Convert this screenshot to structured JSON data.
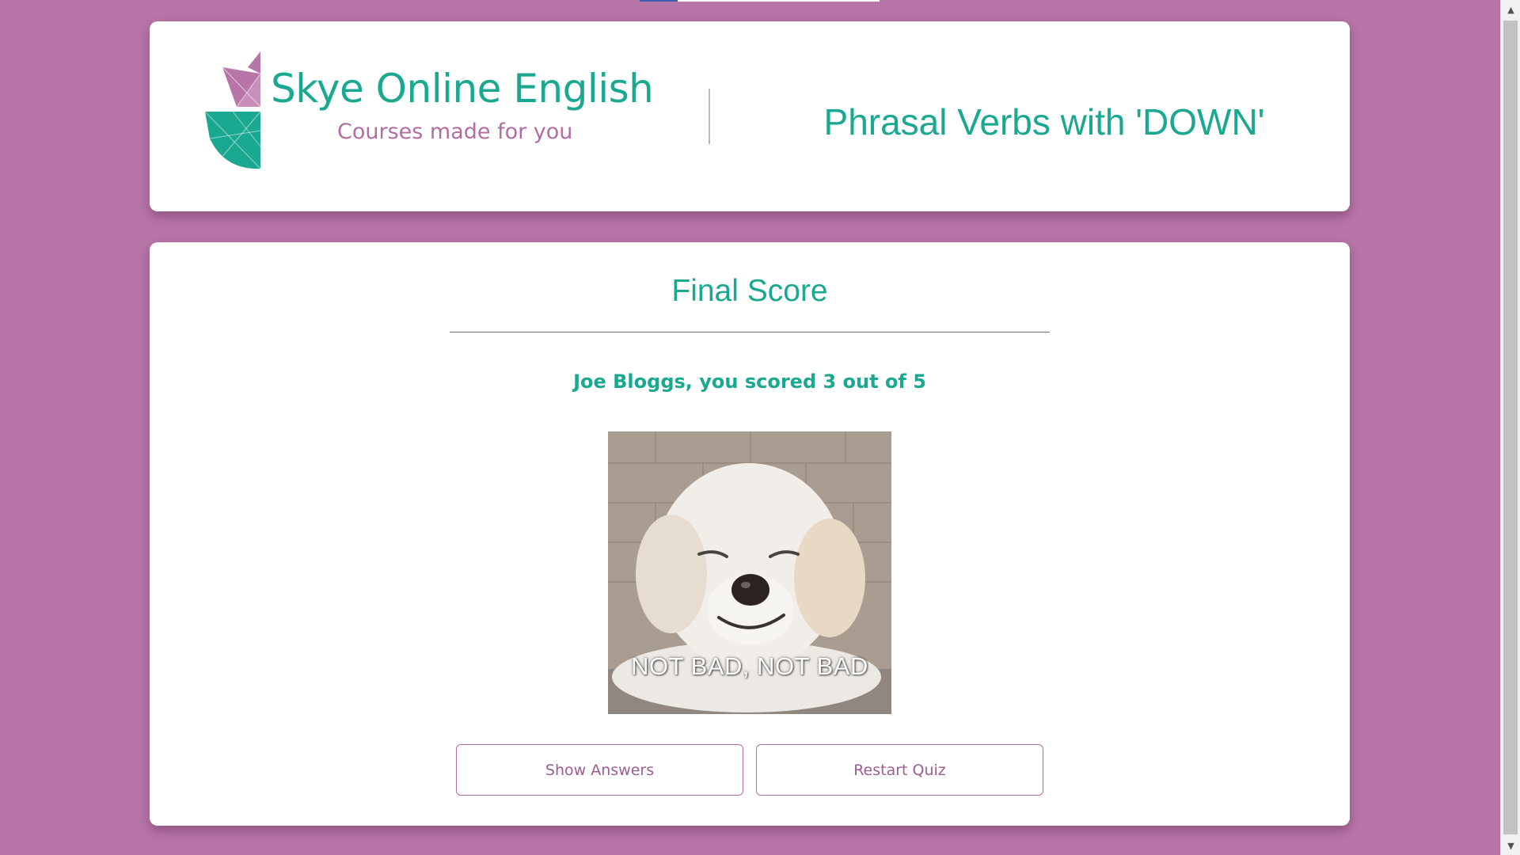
{
  "theme": {
    "background": "#b875a8",
    "accent_teal": "#1ba891",
    "accent_purple": "#b26ea3"
  },
  "progress": {
    "fraction": 0.16
  },
  "header": {
    "logo_title": "Skye Online English",
    "logo_tagline": "Courses made for you",
    "quiz_title": "Phrasal Verbs with 'DOWN'"
  },
  "result": {
    "title": "Final Score",
    "score_text": "Joe Bloggs, you scored 3 out of 5",
    "image_caption": "NOT BAD, NOT BAD"
  },
  "actions": {
    "show_answers": "Show Answers",
    "restart": "Restart Quiz"
  },
  "icons": {
    "scroll_up": "scroll-up-arrow-icon",
    "scroll_down": "scroll-down-arrow-icon",
    "logo": "geometric-leaf-logo-icon"
  }
}
